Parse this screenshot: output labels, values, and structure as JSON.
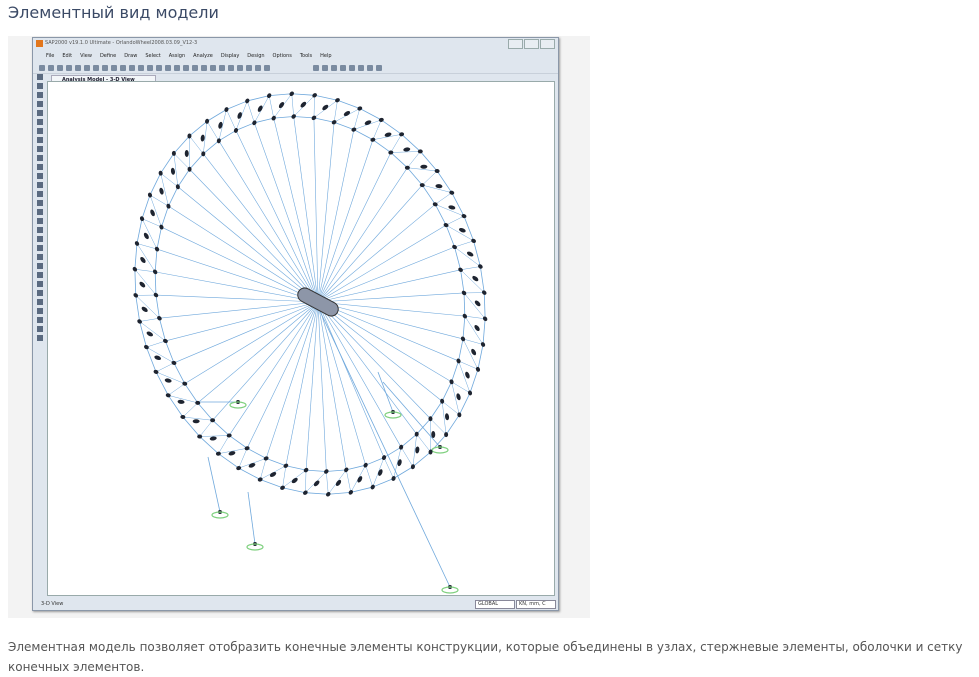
{
  "page": {
    "title": "Элементный вид модели",
    "description": "Элементная модель позволяет отобразить конечные элементы конструкции, которые объединены в узлах, стержневые элементы, оболочки и сетку конечных элементов."
  },
  "app": {
    "window_title": "SAP2000 v19.1.0 Ultimate - OrlandoWheel2008.03.09_V12-3",
    "menu": [
      "File",
      "Edit",
      "View",
      "Define",
      "Draw",
      "Select",
      "Assign",
      "Analyze",
      "Display",
      "Design",
      "Options",
      "Tools",
      "Help"
    ],
    "tab_label": "Analysis Model - 3-D View",
    "status_left": "3-D View",
    "coord_system": "GLOBAL",
    "units": "KN, mm, C"
  },
  "colors": {
    "member": "#6fa8dc",
    "node": "#1e2430",
    "support": "#7fd07f",
    "logo": "#e2761b"
  }
}
